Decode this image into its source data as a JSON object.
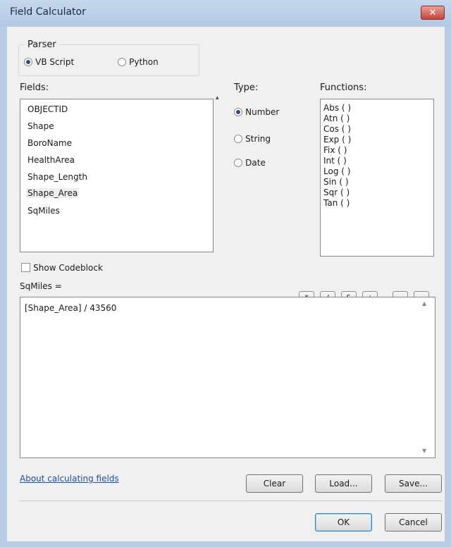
{
  "window": {
    "title": "Field Calculator",
    "close_glyph": "✕"
  },
  "parser": {
    "legend": "Parser",
    "options": [
      {
        "label": "VB Script",
        "selected": true
      },
      {
        "label": "Python",
        "selected": false
      }
    ]
  },
  "fields": {
    "label": "Fields:",
    "items": [
      "OBJECTID",
      "Shape",
      "BoroName",
      "HealthArea",
      "Shape_Length",
      "Shape_Area",
      "SqMiles"
    ],
    "selected_index": 5
  },
  "type": {
    "label": "Type:",
    "options": [
      {
        "label": "Number",
        "selected": true
      },
      {
        "label": "String",
        "selected": false
      },
      {
        "label": "Date",
        "selected": false
      }
    ]
  },
  "functions": {
    "label": "Functions:",
    "items": [
      "Abs ( )",
      "Atn ( )",
      "Cos ( )",
      "Exp ( )",
      "Fix ( )",
      "Int ( )",
      "Log ( )",
      "Sin ( )",
      "Sqr ( )",
      "Tan ( )"
    ]
  },
  "show_codeblock": {
    "label": "Show Codeblock",
    "checked": false
  },
  "operators": [
    "*",
    "/",
    "&",
    "+",
    "-",
    "="
  ],
  "expression": {
    "label": "SqMiles =",
    "value": "[Shape_Area] / 43560"
  },
  "about_link": "About calculating fields",
  "buttons": {
    "clear": "Clear",
    "load": "Load...",
    "save": "Save...",
    "ok": "OK",
    "cancel": "Cancel"
  },
  "icons": {
    "close": "close-icon",
    "scroll_up": "scroll-up-icon",
    "scroll_down": "scroll-down-icon"
  }
}
